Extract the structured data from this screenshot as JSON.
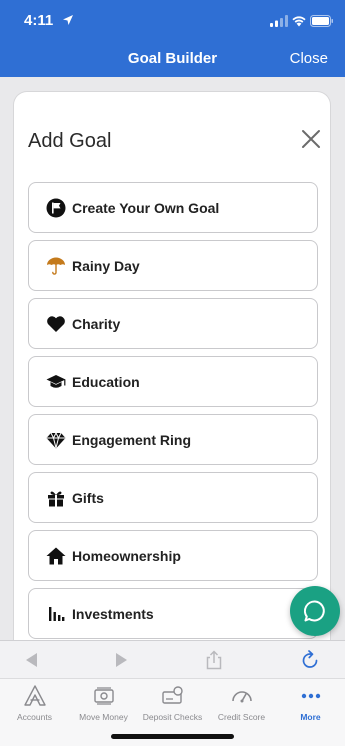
{
  "status_bar": {
    "time": "4:11"
  },
  "nav": {
    "title": "Goal Builder",
    "close_label": "Close"
  },
  "card": {
    "title": "Add Goal"
  },
  "goals": [
    {
      "label": "Create Your Own Goal",
      "icon": "flag-icon"
    },
    {
      "label": "Rainy Day",
      "icon": "umbrella-icon"
    },
    {
      "label": "Charity",
      "icon": "heart-icon"
    },
    {
      "label": "Education",
      "icon": "graduation-cap-icon"
    },
    {
      "label": "Engagement Ring",
      "icon": "diamond-icon"
    },
    {
      "label": "Gifts",
      "icon": "gift-icon"
    },
    {
      "label": "Homeownership",
      "icon": "house-icon"
    },
    {
      "label": "Investments",
      "icon": "bar-chart-icon"
    }
  ],
  "tabbar": {
    "items": [
      {
        "label": "Accounts",
        "icon": "accounts-icon"
      },
      {
        "label": "Move Money",
        "icon": "move-money-icon"
      },
      {
        "label": "Deposit Checks",
        "icon": "deposit-checks-icon"
      },
      {
        "label": "Credit Score",
        "icon": "credit-score-icon"
      },
      {
        "label": "More",
        "icon": "more-icon",
        "active": true
      }
    ]
  },
  "colors": {
    "brand_blue": "#2f6fd4",
    "chat_green": "#1aa183",
    "umbrella": "#c47a1c"
  }
}
